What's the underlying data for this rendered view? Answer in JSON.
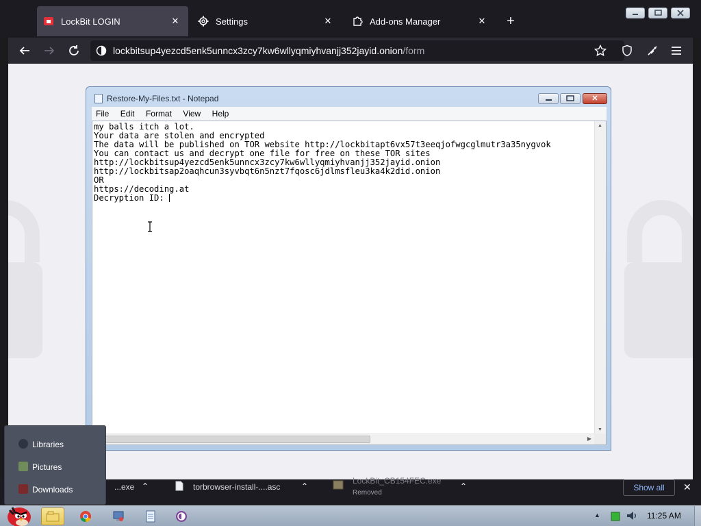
{
  "browser": {
    "tabs": [
      {
        "label": "LockBit LOGIN",
        "icon": "lockbit-favicon-icon",
        "active": true
      },
      {
        "label": "Settings",
        "icon": "gear-icon",
        "active": false
      },
      {
        "label": "Add-ons Manager",
        "icon": "puzzle-icon",
        "active": false
      }
    ],
    "url": {
      "host": "lockbitsup4yezcd5enk5unncx3zcy7kw6wllyqmiyhvanjj352jayid.onion",
      "path": "/form"
    }
  },
  "notepad": {
    "title": "Restore-My-Files.txt - Notepad",
    "menu": [
      "File",
      "Edit",
      "Format",
      "View",
      "Help"
    ],
    "lines": [
      "my balls itch a lot.",
      "",
      "Your data are stolen and encrypted",
      "The data will be published on TOR website http://lockbitapt6vx57t3eeqjofwgcglmutr3a35nygvok",
      "You can contact us and decrypt one file for free on these TOR sites",
      "http://lockbitsup4yezcd5enk5unncx3zcy7kw6wllyqmiyhvanjj352jayid.onion",
      "http://lockbitsap2oaqhcun3syvbqt6n5nzt7fqosc6jdlmsfleu3ka4k2did.onion",
      "OR",
      "https://decoding.at",
      "",
      "Decryption ID: "
    ]
  },
  "downloads": {
    "items": [
      {
        "name": "...exe",
        "status": ""
      },
      {
        "name": "torbrowser-install-....asc",
        "status": ""
      },
      {
        "name": "LockBit_CB154FEC.exe",
        "status": "Removed"
      }
    ],
    "show_all_label": "Show all"
  },
  "jumplist": {
    "items": [
      {
        "label": "Libraries",
        "icon": "libraries-icon"
      },
      {
        "label": "Pictures",
        "icon": "pictures-icon"
      },
      {
        "label": "Downloads",
        "icon": "downloads-icon"
      }
    ]
  },
  "taskbar": {
    "apps": [
      "explorer-icon",
      "chrome-icon",
      "control-panel-icon",
      "notepad-icon",
      "tor-browser-icon"
    ],
    "clock": "11:25 AM"
  },
  "colors": {
    "browser_chrome": "#1c1b22",
    "active_tab": "#42414d",
    "lockbit_red": "#e2313a",
    "show_all_link": "#8ab4f8"
  }
}
